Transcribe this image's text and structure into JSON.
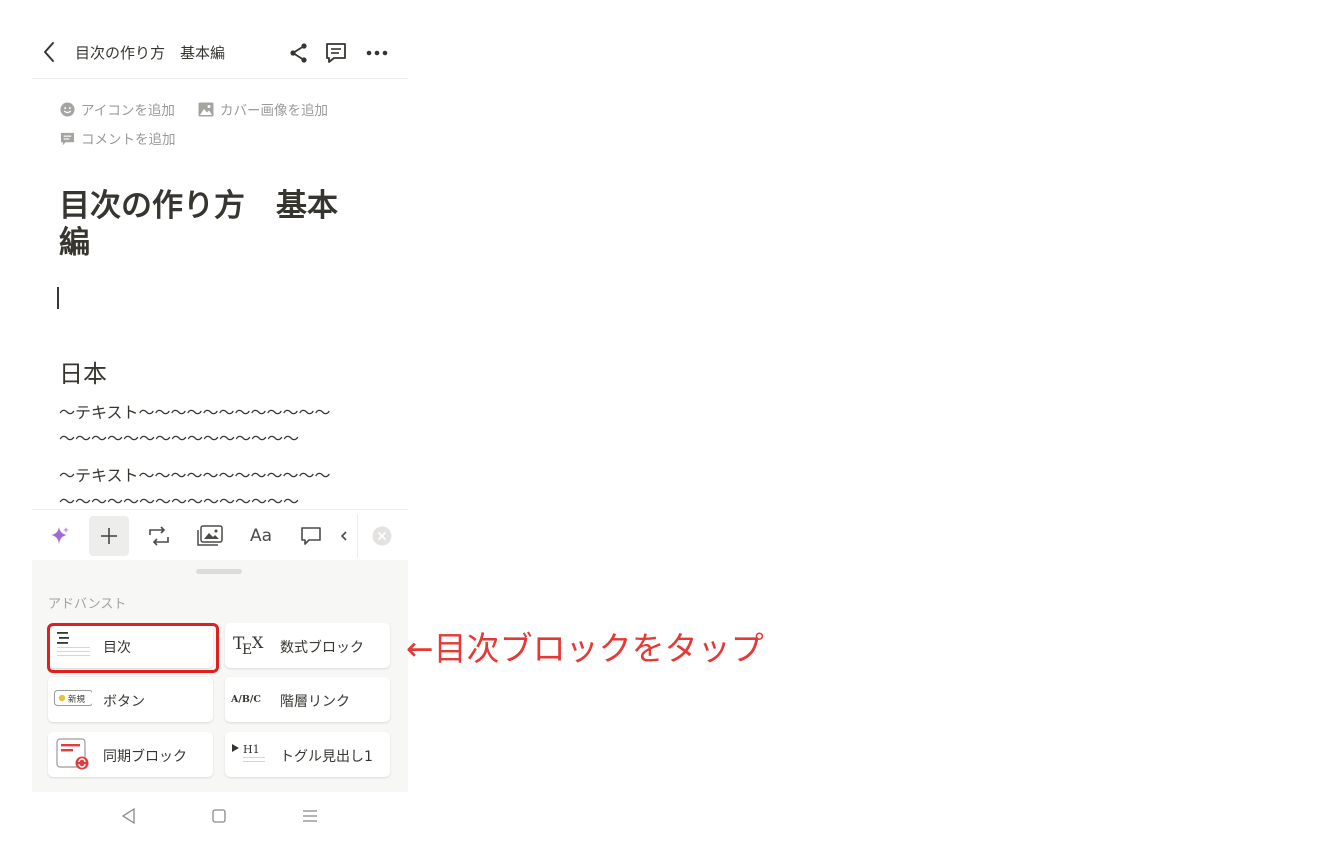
{
  "header": {
    "title": "目次の作り方　基本編"
  },
  "page_meta": {
    "add_icon": "アイコンを追加",
    "add_cover": "カバー画像を追加",
    "add_comment": "コメントを追加"
  },
  "page": {
    "title": "目次の作り方　基本\n編",
    "heading": "日本",
    "paragraphs": [
      "〜テキスト〜〜〜〜〜〜〜〜〜〜〜〜\n〜〜〜〜〜〜〜〜〜〜〜〜〜〜〜",
      "〜テキスト〜〜〜〜〜〜〜〜〜〜〜〜\n〜〜〜〜〜〜〜〜〜〜〜〜〜〜〜"
    ]
  },
  "toolbar": {
    "text_style": "Aa"
  },
  "block_menu": {
    "section_label": "アドバンスト",
    "items": [
      {
        "label": "目次"
      },
      {
        "label": "数式ブロック"
      },
      {
        "label": "ボタン",
        "badge": "新規"
      },
      {
        "label": "階層リンク",
        "icon_text": "A/B/C"
      },
      {
        "label": "同期ブロック"
      },
      {
        "label": "トグル見出し1",
        "icon_text": "H1"
      }
    ]
  },
  "annotation": "←目次ブロックをタップ",
  "colors": {
    "highlight": "#e02020",
    "annotation": "#e53935",
    "sheet_bg": "#f7f7f5"
  }
}
